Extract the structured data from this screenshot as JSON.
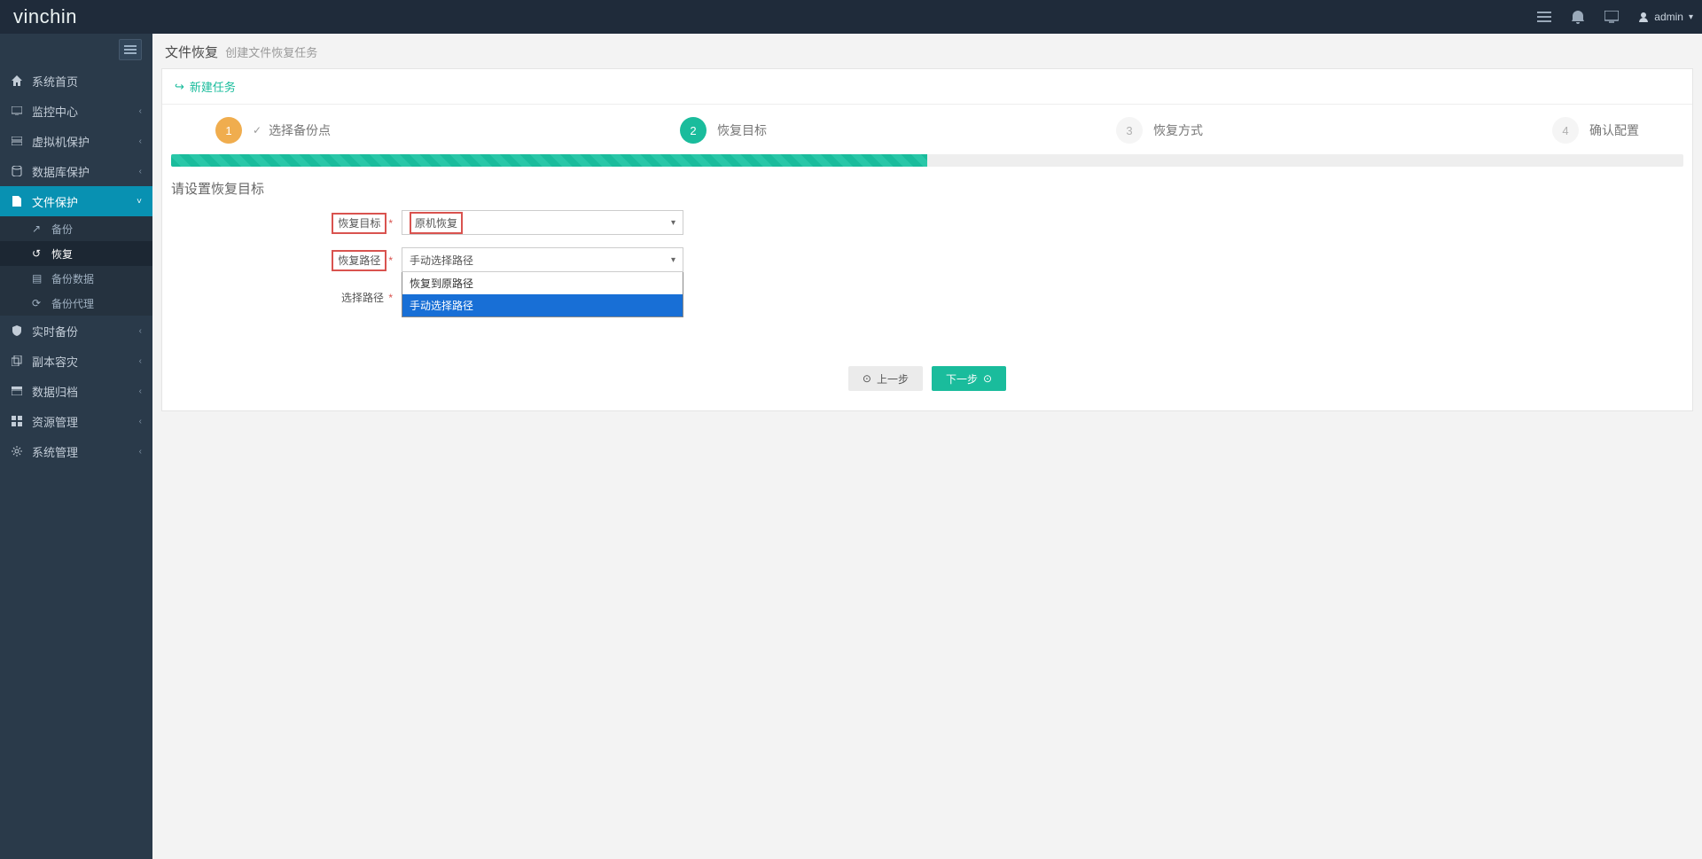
{
  "header": {
    "logo": "vinchin",
    "user": "admin"
  },
  "sidebar": {
    "items": [
      {
        "label": "系统首页"
      },
      {
        "label": "监控中心"
      },
      {
        "label": "虚拟机保护"
      },
      {
        "label": "数据库保护"
      },
      {
        "label": "文件保护"
      },
      {
        "label": "实时备份"
      },
      {
        "label": "副本容灾"
      },
      {
        "label": "数据归档"
      },
      {
        "label": "资源管理"
      },
      {
        "label": "系统管理"
      }
    ],
    "file_sub": [
      {
        "label": "备份"
      },
      {
        "label": "恢复"
      },
      {
        "label": "备份数据"
      },
      {
        "label": "备份代理"
      }
    ]
  },
  "breadcrumb": {
    "main": "文件恢复",
    "sub": "创建文件恢复任务"
  },
  "panel": {
    "title": "新建任务"
  },
  "steps": [
    {
      "num": "1",
      "label": "选择备份点"
    },
    {
      "num": "2",
      "label": "恢复目标"
    },
    {
      "num": "3",
      "label": "恢复方式"
    },
    {
      "num": "4",
      "label": "确认配置"
    }
  ],
  "section_heading": "请设置恢复目标",
  "form": {
    "target_label": "恢复目标",
    "target_value": "原机恢复",
    "path_label": "恢复路径",
    "path_value": "手动选择路径",
    "path_options": [
      "恢复到原路径",
      "手动选择路径"
    ],
    "select_path_label": "选择路径"
  },
  "buttons": {
    "prev": "上一步",
    "next": "下一步"
  }
}
